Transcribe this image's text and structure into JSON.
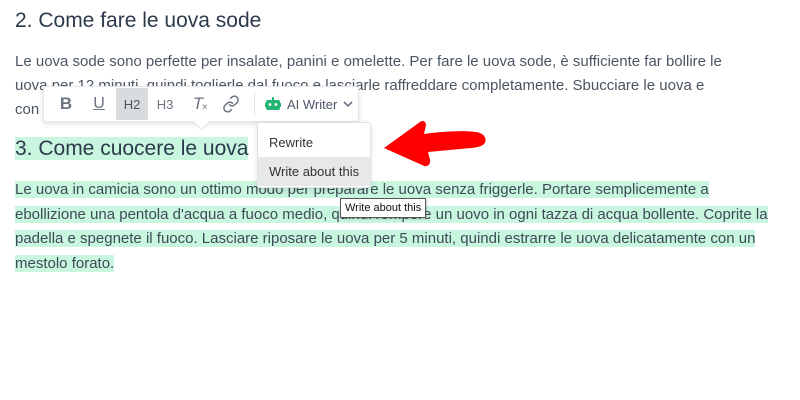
{
  "document": {
    "prev_heading": "2. Come fare le uova sode",
    "paragraph1_line1": "Le uova sode sono perfette per insalate, panini e omelette. Per fare le uova sode, è sufficiente far bollire le",
    "paragraph1_line2": "uova per 12 minuti, quindi toglierle dal fuoco e lasciarle raffreddare completamente. Sbucciare le uova e",
    "paragraph1_line3": "con",
    "selected_heading": "3. Come cuocere le uova",
    "paragraph2": "Le uova in camicia sono un ottimo modo per preparare le uova senza friggerle. Portare semplicemente a ebollizione una pentola d'acqua a fuoco medio, quindi rompere un uovo in ogni tazza di acqua bollente. Coprite la padella e spegnete il fuoco. Lasciare riposare le uova per 5 minuti, quindi estrarre le uova delicatamente con un mestolo forato."
  },
  "toolbar": {
    "bold_label": "B",
    "underline_label": "U",
    "h2_label": "H2",
    "h3_label": "H3",
    "clear_format_label": "T",
    "ai_writer_label": "AI Writer",
    "icons": [
      "bold-icon",
      "underline-icon",
      "clear-format-icon",
      "link-icon",
      "robot-icon",
      "chevron-down-icon"
    ],
    "active_item": "H2"
  },
  "ai_menu": {
    "items": [
      "Rewrite",
      "Write about this"
    ],
    "hovered": "Write about this"
  },
  "tooltip": {
    "text": "Write about this"
  },
  "colors": {
    "highlight": "#c8f6df",
    "robot_icon": "#22b573",
    "arrow": "#ff0000",
    "heading": "#2c3a4b",
    "text": "#4b5563"
  }
}
